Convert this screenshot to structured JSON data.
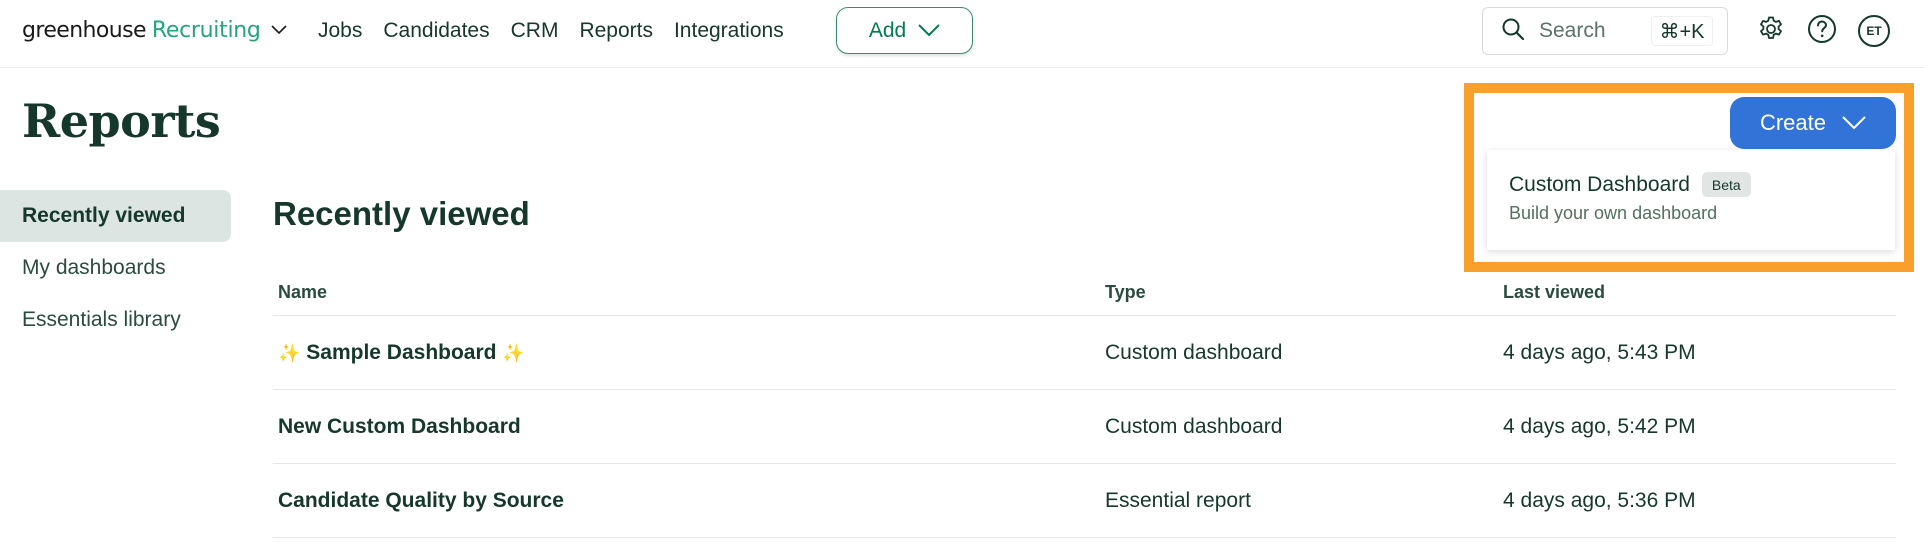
{
  "topbar": {
    "logo": {
      "brand": "greenhouse",
      "product": "Recruiting"
    },
    "nav": [
      {
        "label": "Jobs"
      },
      {
        "label": "Candidates"
      },
      {
        "label": "CRM"
      },
      {
        "label": "Reports"
      },
      {
        "label": "Integrations"
      }
    ],
    "add_button": {
      "label": "Add"
    },
    "search": {
      "placeholder": "Search",
      "shortcut": "⌘+K"
    },
    "icons": {
      "settings": "gear-icon",
      "help": "help-icon"
    },
    "avatar": {
      "initials": "ET"
    }
  },
  "page": {
    "title": "Reports"
  },
  "sidebar": {
    "items": [
      {
        "label": "Recently viewed",
        "active": true
      },
      {
        "label": "My dashboards",
        "active": false
      },
      {
        "label": "Essentials library",
        "active": false
      }
    ]
  },
  "main": {
    "section_title": "Recently viewed",
    "table": {
      "columns": [
        "Name",
        "Type",
        "Last viewed"
      ],
      "rows": [
        {
          "name": "Sample Dashboard",
          "sparkles": "✨",
          "type": "Custom dashboard",
          "last_viewed": "4 days ago, 5:43 PM"
        },
        {
          "name": "New Custom Dashboard",
          "type": "Custom dashboard",
          "last_viewed": "4 days ago, 5:42 PM"
        },
        {
          "name": "Candidate Quality by Source",
          "type": "Essential report",
          "last_viewed": "4 days ago, 5:36 PM"
        }
      ]
    }
  },
  "create_menu": {
    "button_label": "Create",
    "items": [
      {
        "title": "Custom Dashboard",
        "badge": "Beta",
        "subtitle": "Build your own dashboard"
      }
    ]
  },
  "colors": {
    "brand_green": "#24a47f",
    "text_dark": "#15372c",
    "primary_blue": "#3273d8",
    "highlight_orange": "#f9a02c",
    "sidebar_active_bg": "#dde5e2"
  }
}
